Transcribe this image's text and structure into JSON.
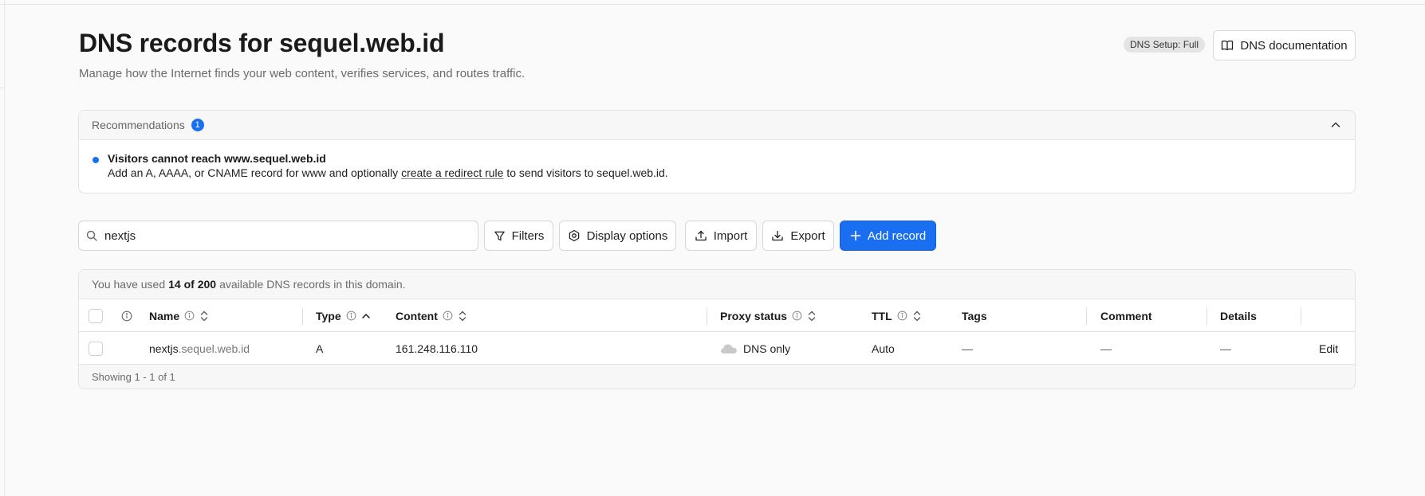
{
  "header": {
    "title": "DNS records for sequel.web.id",
    "subtitle": "Manage how the Internet finds your web content, verifies services, and routes traffic.",
    "setup_badge": "DNS Setup: Full",
    "doc_button": "DNS documentation"
  },
  "recommendations": {
    "label": "Recommendations",
    "count": "1",
    "items": [
      {
        "title": "Visitors cannot reach www.sequel.web.id",
        "text_before": "Add an A, AAAA, or CNAME record for www and optionally ",
        "link": "create a redirect rule",
        "text_after": " to send visitors to sequel.web.id."
      }
    ]
  },
  "toolbar": {
    "search_value": "nextjs",
    "filters": "Filters",
    "display_options": "Display options",
    "import": "Import",
    "export": "Export",
    "add_record": "Add record"
  },
  "usage": {
    "before": "You have used",
    "highlight": "14 of 200",
    "after": "available DNS records in this domain."
  },
  "table": {
    "columns": {
      "name": "Name",
      "type": "Type",
      "content": "Content",
      "proxy": "Proxy status",
      "ttl": "TTL",
      "tags": "Tags",
      "comment": "Comment",
      "details": "Details"
    },
    "rows": [
      {
        "name_sub": "nextjs",
        "name_zone": ".sequel.web.id",
        "type": "A",
        "content": "161.248.116.110",
        "proxy": "DNS only",
        "ttl": "Auto",
        "tags": "—",
        "comment": "—",
        "details": "—",
        "action": "Edit"
      }
    ],
    "footer": "Showing 1 - 1 of 1"
  },
  "colors": {
    "accent": "#1a6ff0",
    "background": "#fafafa"
  },
  "icons": {
    "doc_button": "book-icon",
    "collapse": "chevron-up-icon",
    "search": "search-icon",
    "filters": "filter-icon",
    "display_options": "gear-icon",
    "import": "upload-icon",
    "export": "download-icon",
    "add_record": "plus-icon",
    "proxy": "cloud-icon"
  }
}
